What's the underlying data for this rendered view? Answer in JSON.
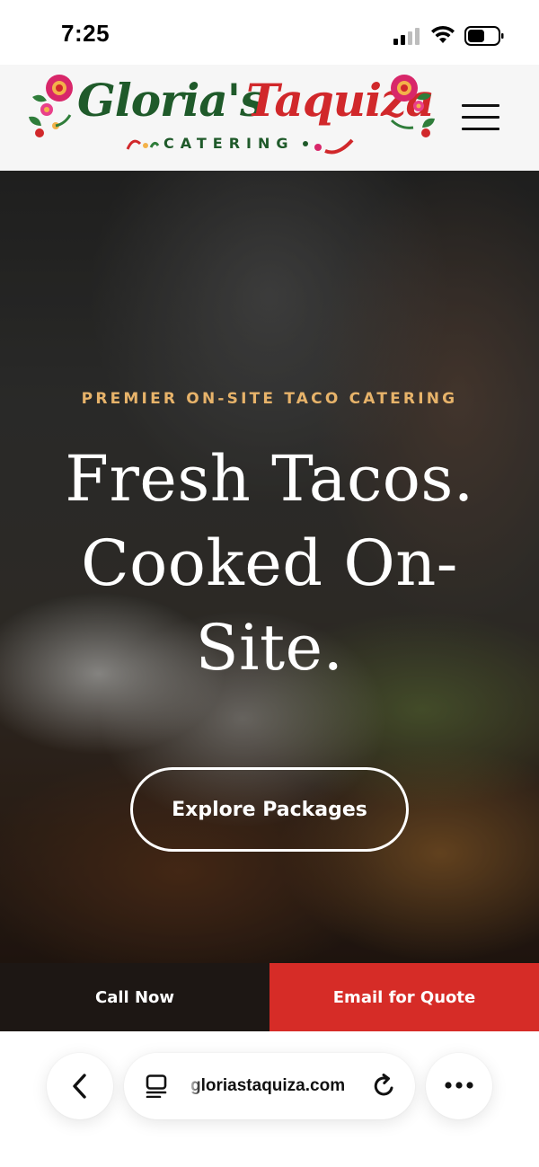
{
  "status_bar": {
    "time": "7:25",
    "icons": [
      "signal-icon",
      "wifi-icon",
      "battery-icon"
    ]
  },
  "header": {
    "logo": {
      "gloria": "Gloria's",
      "taquiza": "Taquiza",
      "catering": "CATERING"
    },
    "menu_icon": "hamburger-menu-icon"
  },
  "hero": {
    "eyebrow": "PREMIER ON-SITE TACO CATERING",
    "title": "Fresh Tacos. Cooked On-Site.",
    "cta_label": "Explore Packages"
  },
  "cta_bar": {
    "call_label": "Call Now",
    "email_label": "Email for Quote"
  },
  "browser": {
    "url": "gloriastaquiza.com",
    "icons": [
      "back-icon",
      "tabs-icon",
      "reload-icon",
      "more-icon"
    ]
  },
  "colors": {
    "eyebrow": "#e7b36a",
    "brand_green": "#1f5a2a",
    "brand_red": "#d1282b",
    "call_bg": "#1d1714",
    "email_bg": "#d62c27"
  }
}
